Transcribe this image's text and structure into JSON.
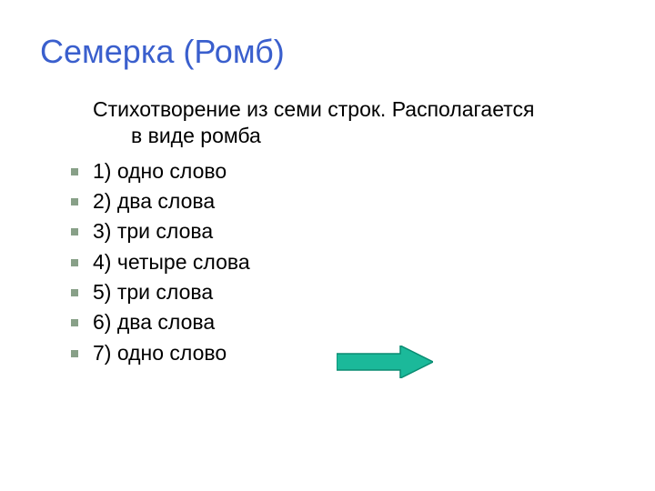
{
  "title": "Семерка (Ромб)",
  "description_line1": "Стихотворение из семи строк. Располагается",
  "description_line2": "в виде ромба",
  "bullets": [
    "1) одно слово",
    "2) два слова",
    "3) три слова",
    "4) четыре слова",
    "5) три слова",
    "6) два слова",
    "7) одно слово"
  ],
  "arrow": {
    "fill": "#1BB99A",
    "stroke": "#0A8C72"
  }
}
